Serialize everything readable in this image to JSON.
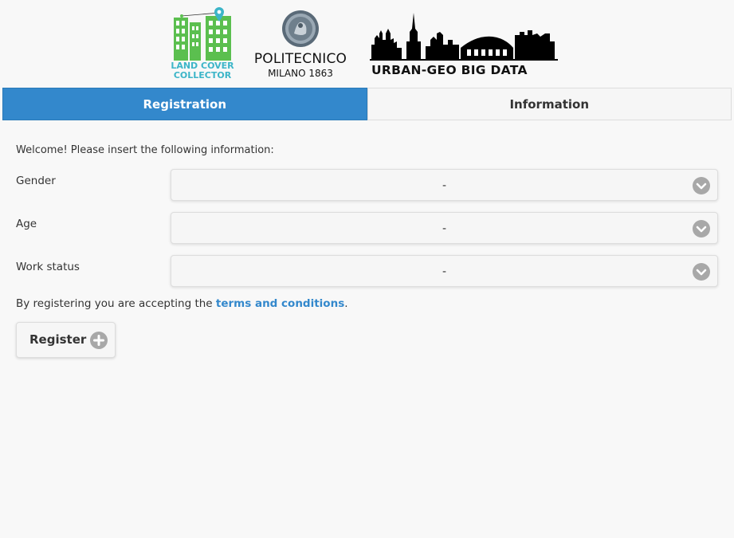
{
  "header": {
    "logo_lcc": {
      "line1": "LAND COVER",
      "line2": "COLLECTOR"
    },
    "logo_polimi": {
      "name": "POLITECNICO",
      "sub": "MILANO 1863"
    },
    "logo_urban": {
      "text": "URBAN-GEO BIG DATA"
    }
  },
  "tabs": [
    {
      "label": "Registration",
      "active": true
    },
    {
      "label": "Information",
      "active": false
    }
  ],
  "form": {
    "welcome": "Welcome! Please insert the following information:",
    "fields": [
      {
        "label": "Gender",
        "value": "-"
      },
      {
        "label": "Age",
        "value": "-"
      },
      {
        "label": "Work status",
        "value": "-"
      }
    ],
    "terms_prefix": "By registering you are accepting the ",
    "terms_link": "terms and conditions",
    "terms_suffix": ".",
    "register_label": "Register"
  },
  "colors": {
    "accent": "#3388cc",
    "icon_grey": "#a8a8a8",
    "logo_green": "#5bbf4f",
    "logo_teal": "#3cb5c8"
  },
  "icons": [
    "chevron-down-icon",
    "plus-icon",
    "map-pin-icon"
  ]
}
